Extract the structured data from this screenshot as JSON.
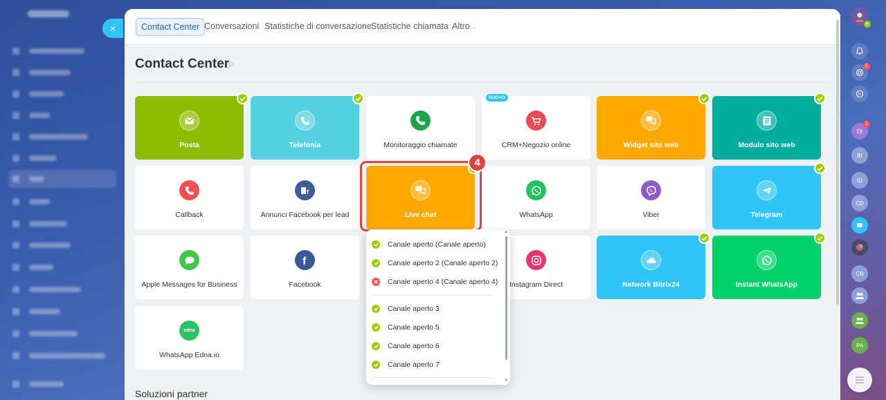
{
  "window": {
    "close_label": "×"
  },
  "tabs": [
    {
      "label": "Contact Center"
    },
    {
      "label": "Conversazioni"
    },
    {
      "label": "Statistiche di conversazione"
    },
    {
      "label": "Statistiche chiamata"
    },
    {
      "label": "Altro"
    }
  ],
  "page": {
    "title": "Contact Center",
    "section_title": "Soluzioni partner",
    "step_number": "4"
  },
  "tiles": [
    {
      "label": "Posta",
      "color": "#8fbc00",
      "icon": "mail-icon",
      "connected": true
    },
    {
      "label": "Telefonia",
      "color": "#55d0e0",
      "icon": "phone-icon",
      "connected": true
    },
    {
      "label": "Monitoraggio chiamate",
      "color": "#ffffff",
      "icon": "call-monitoring-icon",
      "connected": false
    },
    {
      "label": "CRM+Negozio online",
      "color": "#ffffff",
      "icon": "shop-cart-icon",
      "connected": false,
      "badge": "NUOVO"
    },
    {
      "label": "Widget sito web",
      "color": "#ffa900",
      "icon": "chat-bubbles-icon",
      "connected": true
    },
    {
      "label": "Modulo sito web",
      "color": "#00aea0",
      "icon": "form-icon",
      "connected": true
    },
    {
      "label": "Callback",
      "color": "#ffffff",
      "icon": "callback-icon",
      "connected": false
    },
    {
      "label": "Annunci Facebook per lead",
      "color": "#ffffff",
      "icon": "facebook-lead-icon",
      "connected": false
    },
    {
      "label": "Live chat",
      "color": "#ffa900",
      "icon": "live-chat-icon",
      "connected": true
    },
    {
      "label": "WhatsApp",
      "color": "#ffffff",
      "icon": "whatsapp-icon",
      "connected": false
    },
    {
      "label": "Viber",
      "color": "#ffffff",
      "icon": "viber-icon",
      "connected": false
    },
    {
      "label": "Telegram",
      "color": "#2fc6f6",
      "icon": "telegram-icon",
      "connected": true
    },
    {
      "label": "Apple Messages for Business",
      "color": "#ffffff",
      "icon": "apple-messages-icon",
      "connected": false
    },
    {
      "label": "Facebook",
      "color": "#ffffff",
      "icon": "facebook-icon",
      "connected": false
    },
    {
      "label": "Instagram Direct",
      "color": "#ffffff",
      "icon": "instagram-icon",
      "connected": false
    },
    {
      "label": "Network Bitrix24",
      "color": "#2fc6f6",
      "icon": "cloud-icon",
      "connected": true
    },
    {
      "label": "Instant WhatsApp",
      "color": "#00d26a",
      "icon": "whatsapp-icon",
      "connected": true
    },
    {
      "label": "WhatsApp Edna.io",
      "color": "#ffffff",
      "icon": "edna-icon",
      "connected": false,
      "icon_text": "edna"
    }
  ],
  "dropdown": {
    "items": [
      {
        "label": "Canale aperto (Canale aperto)",
        "status": "ok"
      },
      {
        "label": "Canale aperto 2 (Canale aperto 2)",
        "status": "ok"
      },
      {
        "label": "Canale aperto 4 (Canale aperto 4)",
        "status": "error"
      },
      {
        "label": "Canale aperto 3",
        "status": "ok"
      },
      {
        "label": "Canale aperto 5",
        "status": "ok"
      },
      {
        "label": "Canale aperto 6",
        "status": "ok"
      },
      {
        "label": "Canale aperto 7",
        "status": "ok"
      }
    ]
  },
  "right_sidebar": {
    "avatars": [
      {
        "initials": "DI",
        "badge": "1",
        "color": "#9b7ad8"
      },
      {
        "initials": "BI",
        "color": "#8fa0d8"
      },
      {
        "initials": "ID",
        "color": "#8fa0d8"
      },
      {
        "initials": "CD",
        "color": "#8fa0d8"
      },
      {
        "initials": "CB",
        "color": "#8fa0d8"
      },
      {
        "initials": "PA",
        "color": "#6ab04c"
      }
    ],
    "notification_badges": [
      "1"
    ]
  },
  "colors": {
    "accent": "#2fc6f6",
    "check": "#9dcf00",
    "error": "#ff5752",
    "highlight": "#e0423f"
  }
}
